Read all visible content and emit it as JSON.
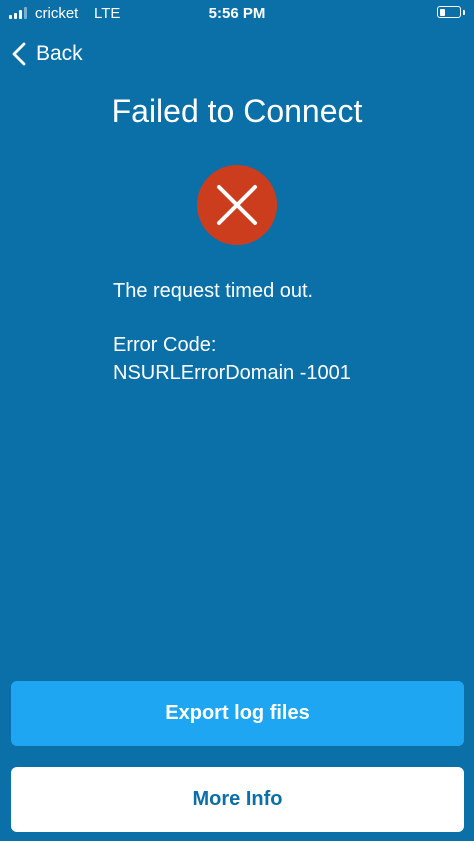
{
  "status_bar": {
    "carrier": "cricket",
    "network": "LTE",
    "time": "5:56 PM",
    "battery_level": 0.3,
    "signal_bars_filled": 3,
    "signal_bars_total": 4
  },
  "nav": {
    "back_label": "Back",
    "back_icon": "chevron-left-icon"
  },
  "title": "Failed to Connect",
  "error_icon": {
    "name": "error-x-icon",
    "color": "#cc3d1e"
  },
  "message": "The request timed out.",
  "error_code": {
    "label": "Error Code:",
    "value": "NSURLErrorDomain -1001"
  },
  "buttons": {
    "export_label": "Export log files",
    "more_info_label": "More Info"
  },
  "colors": {
    "background": "#0b6fa8",
    "primary_button": "#1fa6f2",
    "secondary_button": "#ffffff",
    "secondary_button_text": "#0b6fa8"
  }
}
